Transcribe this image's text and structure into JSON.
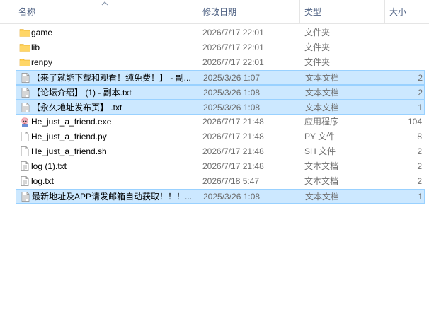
{
  "columns": {
    "name": "名称",
    "modified": "修改日期",
    "type": "类型",
    "size": "大小"
  },
  "files": [
    {
      "name": "game",
      "modified": "2026/7/17 22:01",
      "type": "文件夹",
      "size": "",
      "icon": "folder-icon",
      "selected": false
    },
    {
      "name": "lib",
      "modified": "2026/7/17 22:01",
      "type": "文件夹",
      "size": "",
      "icon": "folder-icon",
      "selected": false
    },
    {
      "name": "renpy",
      "modified": "2026/7/17 22:01",
      "type": "文件夹",
      "size": "",
      "icon": "folder-icon",
      "selected": false
    },
    {
      "name": "【来了就能下载和观看！纯免费！】 - 副...",
      "modified": "2025/3/26 1:07",
      "type": "文本文档",
      "size": "2",
      "icon": "text-document-icon",
      "selected": true
    },
    {
      "name": "【论坛介绍】 (1) - 副本.txt",
      "modified": "2025/3/26 1:08",
      "type": "文本文档",
      "size": "2",
      "icon": "text-document-icon",
      "selected": true
    },
    {
      "name": "【永久地址发布页】 .txt",
      "modified": "2025/3/26 1:08",
      "type": "文本文档",
      "size": "1",
      "icon": "text-document-icon",
      "selected": true
    },
    {
      "name": "He_just_a_friend.exe",
      "modified": "2026/7/17 21:48",
      "type": "应用程序",
      "size": "104",
      "icon": "application-icon",
      "selected": false
    },
    {
      "name": "He_just_a_friend.py",
      "modified": "2026/7/17 21:48",
      "type": "PY 文件",
      "size": "8",
      "icon": "blank-file-icon",
      "selected": false
    },
    {
      "name": "He_just_a_friend.sh",
      "modified": "2026/7/17 21:48",
      "type": "SH 文件",
      "size": "2",
      "icon": "blank-file-icon",
      "selected": false
    },
    {
      "name": "log (1).txt",
      "modified": "2026/7/17 21:48",
      "type": "文本文档",
      "size": "2",
      "icon": "text-document-icon",
      "selected": false
    },
    {
      "name": "log.txt",
      "modified": "2026/7/18 5:47",
      "type": "文本文档",
      "size": "2",
      "icon": "text-document-icon",
      "selected": false
    },
    {
      "name": "最新地址及APP请发邮箱自动获取！！！...",
      "modified": "2025/3/26 1:08",
      "type": "文本文档",
      "size": "1",
      "icon": "text-document-icon",
      "selected": true
    }
  ],
  "colors": {
    "selection_bg": "#cce8ff",
    "selection_border": "#99d1ff",
    "folder": "#ffc83d",
    "header_text": "#4d6082"
  }
}
